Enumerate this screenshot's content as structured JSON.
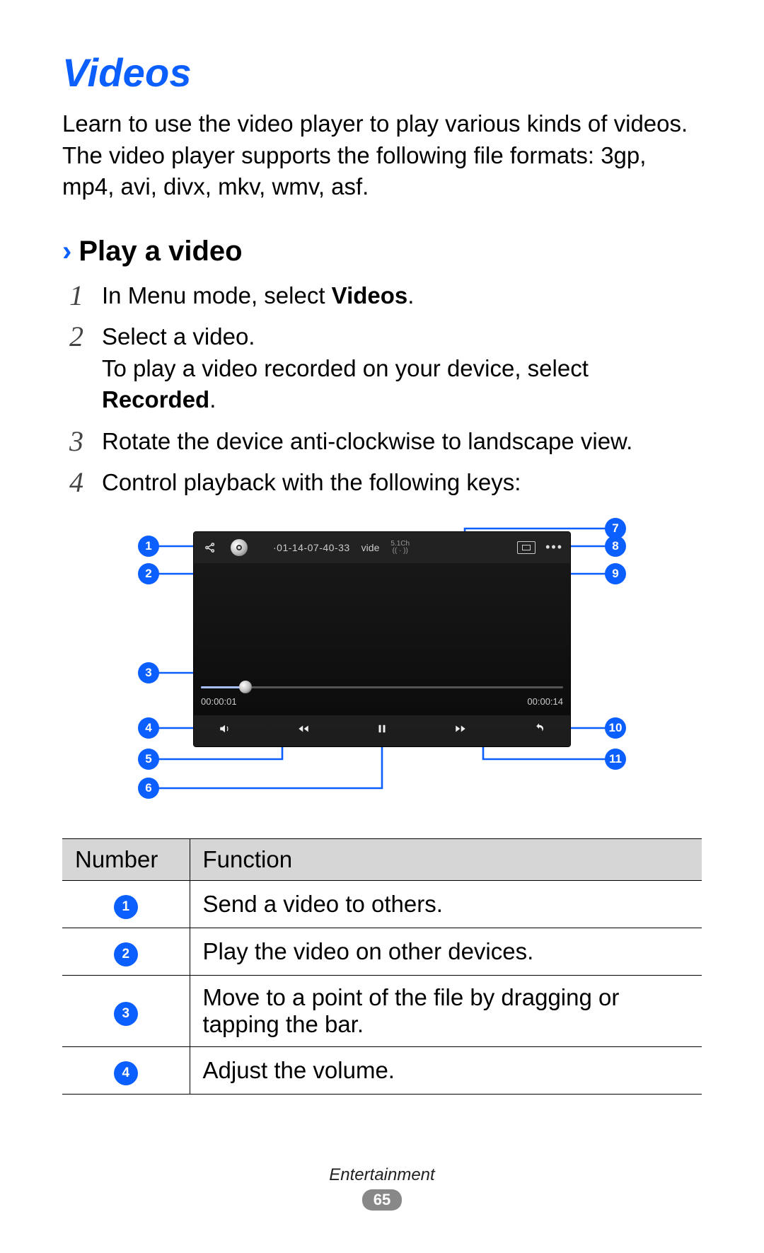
{
  "heading": "Videos",
  "intro": "Learn to use the video player to play various kinds of videos. The video player supports the following file formats: 3gp, mp4, avi, divx, mkv, wmv, asf.",
  "subsection": {
    "chevron": "›",
    "title": "Play a video"
  },
  "steps": [
    {
      "num": "1",
      "before": "In Menu mode, select ",
      "bold": "Videos",
      "after": "."
    },
    {
      "num": "2",
      "before": "Select a video.\nTo play a video recorded on your device, select ",
      "bold": "Recorded",
      "after": "."
    },
    {
      "num": "3",
      "before": "Rotate the device anti-clockwise to landscape view.",
      "bold": "",
      "after": ""
    },
    {
      "num": "4",
      "before": "Control playback with the following keys:",
      "bold": "",
      "after": ""
    }
  ],
  "player": {
    "title": "·01-14-07-40-33",
    "label_video": "vide",
    "ch_top": "5.1Ch",
    "ch_bottom": "(( · ))",
    "dots": "•••",
    "time_current": "00:00:01",
    "time_total": "00:00:14"
  },
  "callouts": [
    "1",
    "2",
    "3",
    "4",
    "5",
    "6",
    "7",
    "8",
    "9",
    "10",
    "11"
  ],
  "table": {
    "headers": [
      "Number",
      "Function"
    ],
    "rows": [
      {
        "n": "1",
        "f": "Send a video to others."
      },
      {
        "n": "2",
        "f": "Play the video on other devices."
      },
      {
        "n": "3",
        "f": "Move to a point of the file by dragging or tapping the bar."
      },
      {
        "n": "4",
        "f": "Adjust the volume."
      }
    ]
  },
  "footer": {
    "category": "Entertainment",
    "page": "65"
  }
}
